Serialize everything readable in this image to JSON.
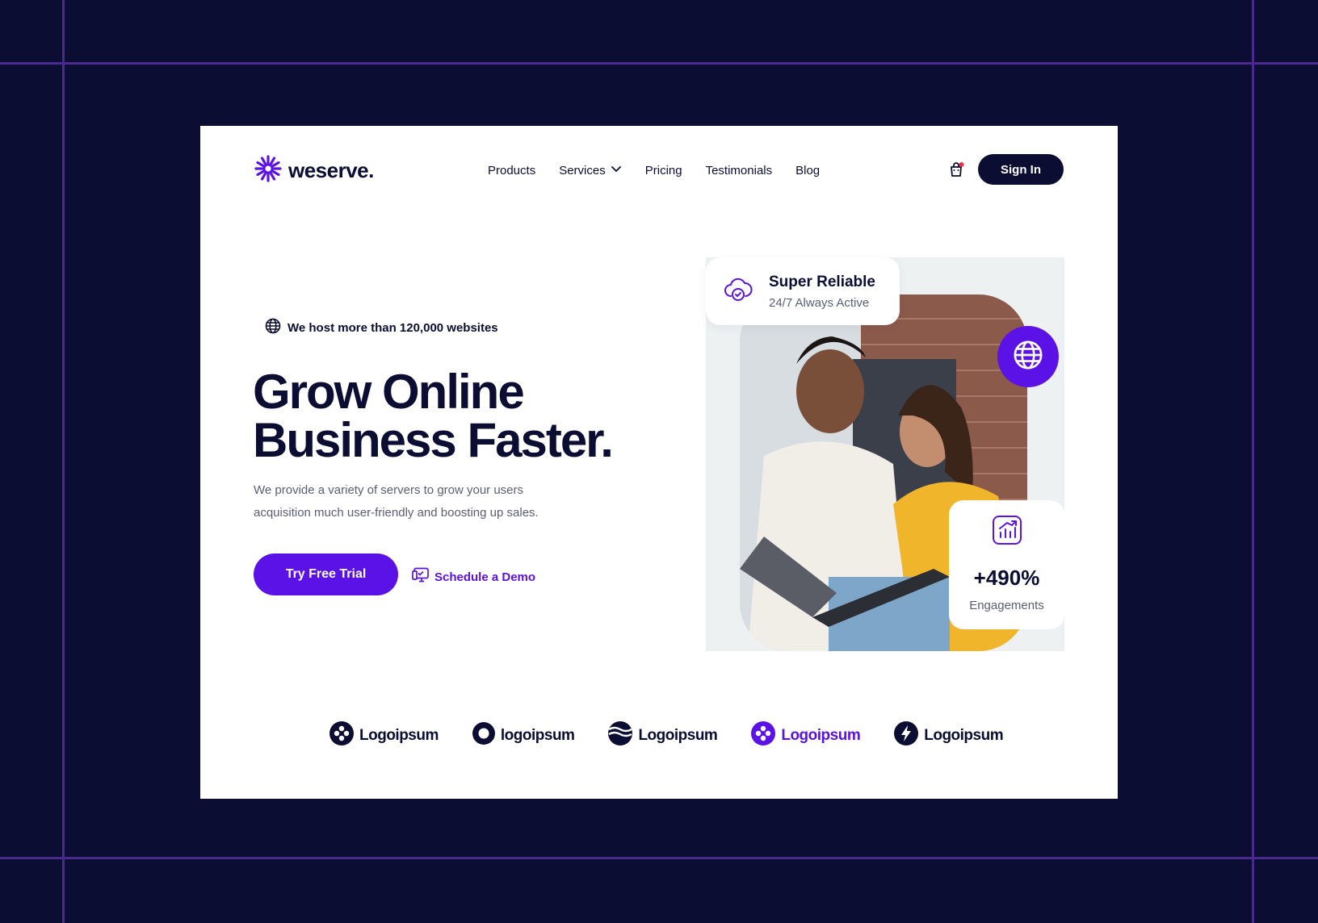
{
  "colors": {
    "background": "#0b0d33",
    "accent": "#5b12e6",
    "text": "#0b0d33",
    "muted": "#5b5d75",
    "panel": "#eef1f2"
  },
  "brand": {
    "name": "weserve.",
    "icon": "flower-icon"
  },
  "nav": {
    "items": [
      "Products",
      "Services",
      "Pricing",
      "Testimonials",
      "Blog"
    ],
    "services_icon": "chevron-down-icon"
  },
  "header": {
    "cart_icon": "shopping-bag-icon",
    "signin_label": "Sign In"
  },
  "hero": {
    "badge": "We host more than 120,000 websites",
    "title_line1": "Grow Online",
    "title_line2": "Business Faster.",
    "subtitle_line1": "We provide a variety of servers to grow your users",
    "subtitle_line2": "acquisition much user-friendly and boosting up sales.",
    "cta_primary": "Try Free Trial",
    "cta_secondary": "Schedule a Demo",
    "cta_secondary_icon": "monitor-icon"
  },
  "cards": {
    "reliable_title": "Super Reliable",
    "reliable_sub": "24/7 Always Active",
    "reliable_icon": "cloud-check-icon",
    "globe_icon": "globe-icon",
    "engagement_value": "+490%",
    "engagement_label": "Engagements",
    "engagement_icon": "chart-up-icon"
  },
  "partners": [
    "Logoipsum",
    "logoipsum",
    "Logoipsum",
    "Logoipsum",
    "Logoipsum"
  ]
}
